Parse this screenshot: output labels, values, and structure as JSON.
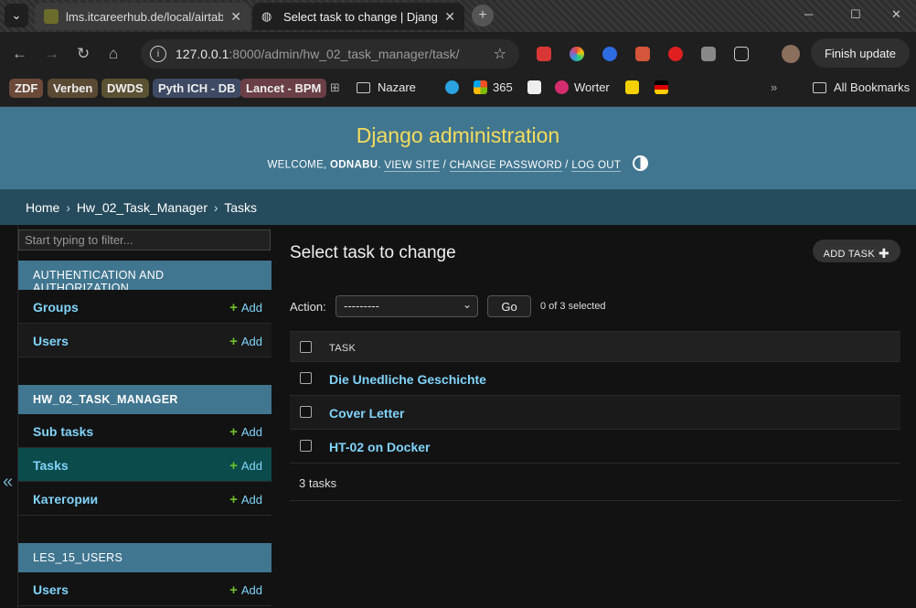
{
  "browser": {
    "tabs": [
      {
        "title": "lms.itcareerhub.de/local/airtabl"
      },
      {
        "title": "Select task to change | Django a"
      }
    ],
    "url_host": "127.0.0.1",
    "url_rest": ":8000/admin/hw_02_task_manager/task/",
    "finish_update": "Finish update",
    "bookmark_chips": [
      {
        "label": "ZDF",
        "color": "#6b4a3a"
      },
      {
        "label": "Verben",
        "color": "#5a4a34"
      },
      {
        "label": "DWDS",
        "color": "#5a5233"
      },
      {
        "label": "Pyth ICH - DB",
        "color": "#3e4a63"
      },
      {
        "label": "Lancet - BPM",
        "color": "#6a3f45"
      }
    ],
    "bookmarks": {
      "nazare": "Nazare",
      "b365": "365",
      "worter": "Worter",
      "all": "All Bookmarks"
    }
  },
  "admin": {
    "brand": "Django administration",
    "welcome": "WELCOME,",
    "username": "ODNABU",
    "view_site": "VIEW SITE",
    "change_password": "CHANGE PASSWORD",
    "logout": "LOG OUT",
    "breadcrumbs": [
      "Home",
      "Hw_02_Task_Manager",
      "Tasks"
    ],
    "collapse": "«"
  },
  "sidebar": {
    "filter_placeholder": "Start typing to filter...",
    "add_label": "Add",
    "modules": [
      {
        "caption": "AUTHENTICATION AND AUTHORIZATION",
        "items": [
          "Groups",
          "Users"
        ]
      },
      {
        "caption": "HW_02_TASK_MANAGER",
        "items": [
          "Sub tasks",
          "Tasks",
          "Категории"
        ]
      },
      {
        "caption": "LES_15_USERS",
        "items": [
          "Users"
        ]
      }
    ]
  },
  "content": {
    "title": "Select task to change",
    "add_button": "ADD TASK",
    "action_label": "Action:",
    "action_selected": "---------",
    "go": "Go",
    "selected_count": "0 of 3 selected",
    "column": "TASK",
    "rows": [
      "Die Unedliche Geschichte",
      "Cover Letter",
      "HT-02 on Docker"
    ],
    "paginator": "3 tasks"
  }
}
